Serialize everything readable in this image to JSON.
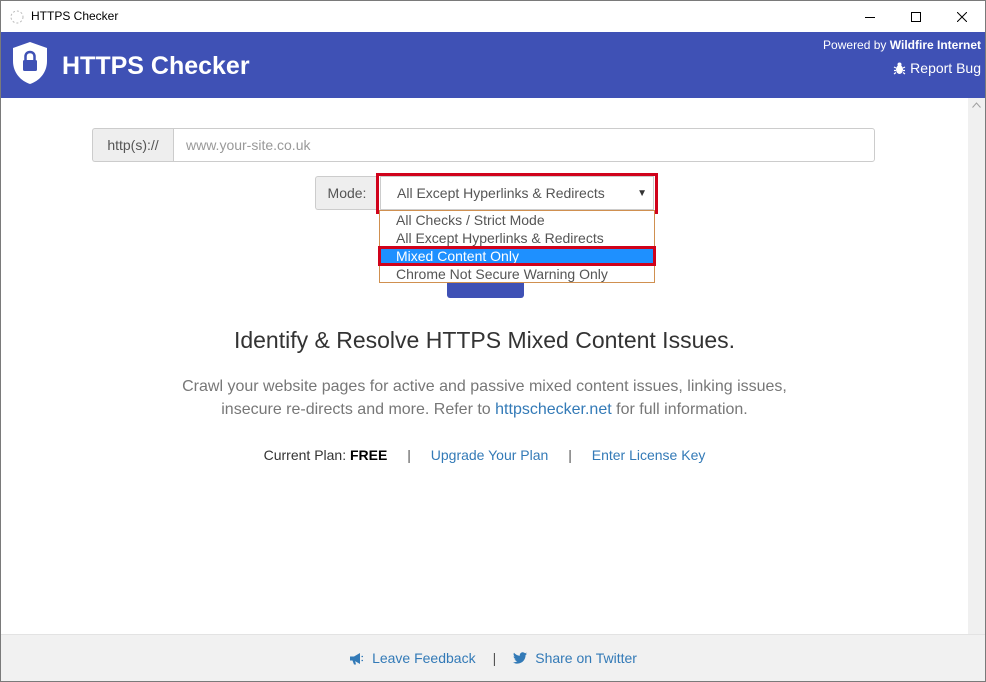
{
  "window": {
    "title": "HTTPS Checker",
    "minimize_icon": "minimize-icon",
    "maximize_icon": "maximize-icon",
    "close_icon": "close-icon"
  },
  "header": {
    "brand": "HTTPS Checker",
    "logo_icon": "shield-lock-icon",
    "powered_prefix": "Powered by",
    "powered_name": "Wildfire Internet",
    "report_bug": "Report Bug",
    "report_icon": "bug-icon",
    "accent": "#3f51b5"
  },
  "url_form": {
    "prefix": "http(s)://",
    "placeholder": "www.your-site.co.uk",
    "value": ""
  },
  "mode": {
    "label": "Mode:",
    "selected": "All Except Hyperlinks & Redirects",
    "options": [
      "All Checks / Strict Mode",
      "All Except Hyperlinks & Redirects",
      "Mixed Content Only",
      "Chrome Not Secure Warning Only"
    ],
    "highlighted_option": "Mixed Content Only",
    "highlight_color": "#1e90ff",
    "annotation_color": "#d0021b"
  },
  "hero": {
    "headline": "Identify & Resolve HTTPS Mixed Content Issues.",
    "desc_line1": "Crawl your website pages for active and passive mixed content issues, linking issues,",
    "desc_line2_pre": "insecure re-directs and more. Refer to",
    "desc_link": "httpschecker.net",
    "desc_line2_post": "for full information."
  },
  "plan": {
    "label": "Current Plan:",
    "value": "FREE",
    "separator": "|",
    "upgrade": "Upgrade Your Plan",
    "license": "Enter License Key"
  },
  "footer": {
    "feedback": "Leave Feedback",
    "feedback_icon": "megaphone-icon",
    "separator": "|",
    "twitter": "Share on Twitter",
    "twitter_icon": "twitter-icon"
  }
}
